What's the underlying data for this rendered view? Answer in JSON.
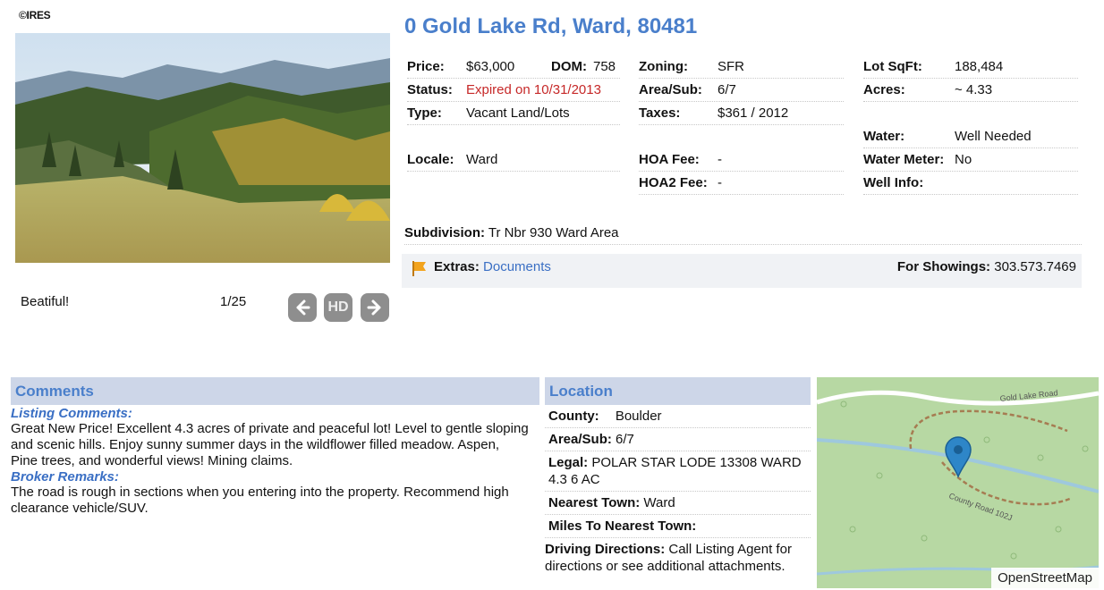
{
  "logo": "©IRES",
  "photo": {
    "caption": "Beatiful!",
    "counter": "1/25",
    "hd_label": "HD"
  },
  "listing": {
    "title": "0 Gold Lake Rd, Ward, 80481",
    "price_label": "Price:",
    "price": "$63,000",
    "dom_label": "DOM:",
    "dom": "758",
    "status_label": "Status:",
    "status": "Expired on 10/31/2013",
    "type_label": "Type:",
    "type": "Vacant Land/Lots",
    "locale_label": "Locale:",
    "locale": "Ward",
    "zoning_label": "Zoning:",
    "zoning": "SFR",
    "areasub_label": "Area/Sub:",
    "areasub": "6/7",
    "taxes_label": "Taxes:",
    "taxes": "$361 / 2012",
    "hoa_label": "HOA Fee:",
    "hoa": "-",
    "hoa2_label": "HOA2 Fee:",
    "hoa2": "-",
    "lotsqft_label": "Lot SqFt:",
    "lotsqft": "188,484",
    "acres_label": "Acres:",
    "acres": "~ 4.33",
    "water_label": "Water:",
    "water": "Well Needed",
    "watermeter_label": "Water Meter:",
    "watermeter": "No",
    "wellinfo_label": "Well Info:",
    "subdivision_label": "Subdivision:",
    "subdivision": "Tr Nbr 930 Ward Area",
    "extras_label": "Extras:",
    "extras_link": "Documents",
    "showings_label": "For Showings:",
    "showings": "303.573.7469"
  },
  "comments": {
    "header": "Comments",
    "listing_label": "Listing Comments:",
    "listing_text": "Great New Price! Excellent 4.3 acres of private and peaceful lot! Level to gentle sloping and scenic hills. Enjoy sunny summer days in the wildflower filled meadow. Aspen, Pine trees, and wonderful views! Mining claims.",
    "broker_label": "Broker Remarks:",
    "broker_text": "The road is rough in sections when you entering into the property. Recommend high clearance vehicle/SUV."
  },
  "location": {
    "header": "Location",
    "county_label": "County:",
    "county": "Boulder",
    "areasub_label": "Area/Sub:",
    "areasub": "6/7",
    "legal_label": "Legal:",
    "legal": "POLAR STAR LODE 13308 WARD 4.3 6 AC",
    "town_label": "Nearest Town:",
    "town": "Ward",
    "miles_label": "Miles To Nearest Town:",
    "directions_label": "Driving Directions:",
    "directions": "Call Listing Agent for directions or see additional attachments."
  },
  "map": {
    "attribution": "OpenStreetMap",
    "road1": "Gold Lake Road",
    "road2": "County Road 102J"
  },
  "colors": {
    "accent": "#4a7fcb",
    "panel_header": "#cdd6e8",
    "status_red": "#c62828",
    "map_green": "#b7d8a3"
  }
}
